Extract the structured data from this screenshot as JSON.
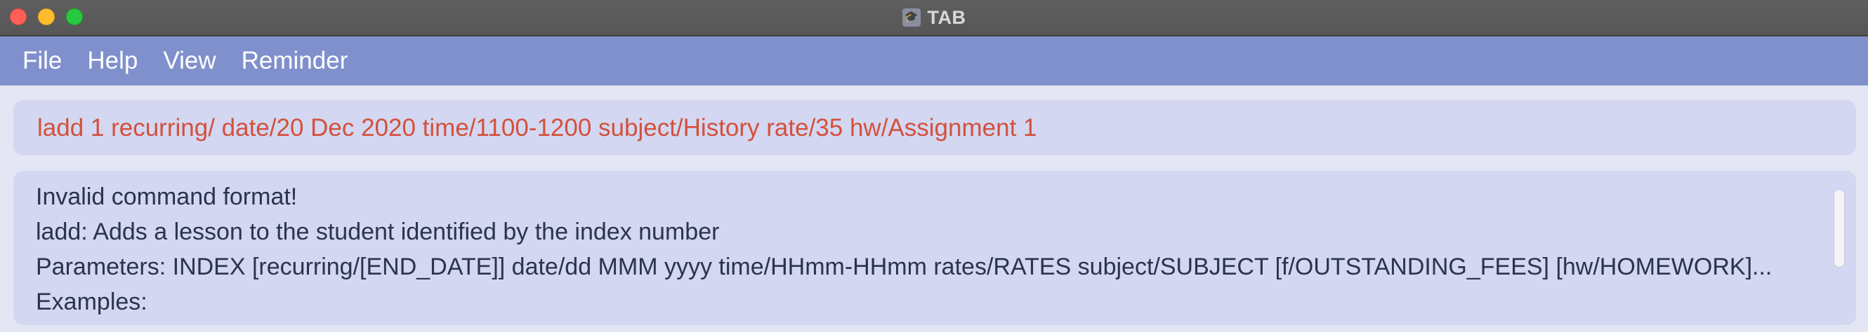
{
  "window": {
    "title": "TAB",
    "app_icon": "graduation-cap-icon"
  },
  "menu": {
    "items": [
      {
        "label": "File"
      },
      {
        "label": "Help"
      },
      {
        "label": "View"
      },
      {
        "label": "Reminder"
      }
    ]
  },
  "command": {
    "value": "ladd 1 recurring/ date/20 Dec 2020 time/1100-1200 subject/History rate/35 hw/Assignment 1",
    "color": "#d4503b"
  },
  "result": {
    "lines": [
      "Invalid command format!",
      "ladd: Adds a lesson to the student identified by the index number",
      "Parameters: INDEX [recurring/[END_DATE]] date/dd MMM yyyy time/HHmm-HHmm rates/RATES subject/SUBJECT [f/OUTSTANDING_FEES] [hw/HOMEWORK]...",
      "Examples:"
    ]
  },
  "colors": {
    "menubar": "#8090cc",
    "panel": "#d3d7f1",
    "background": "#e4e6f4"
  }
}
